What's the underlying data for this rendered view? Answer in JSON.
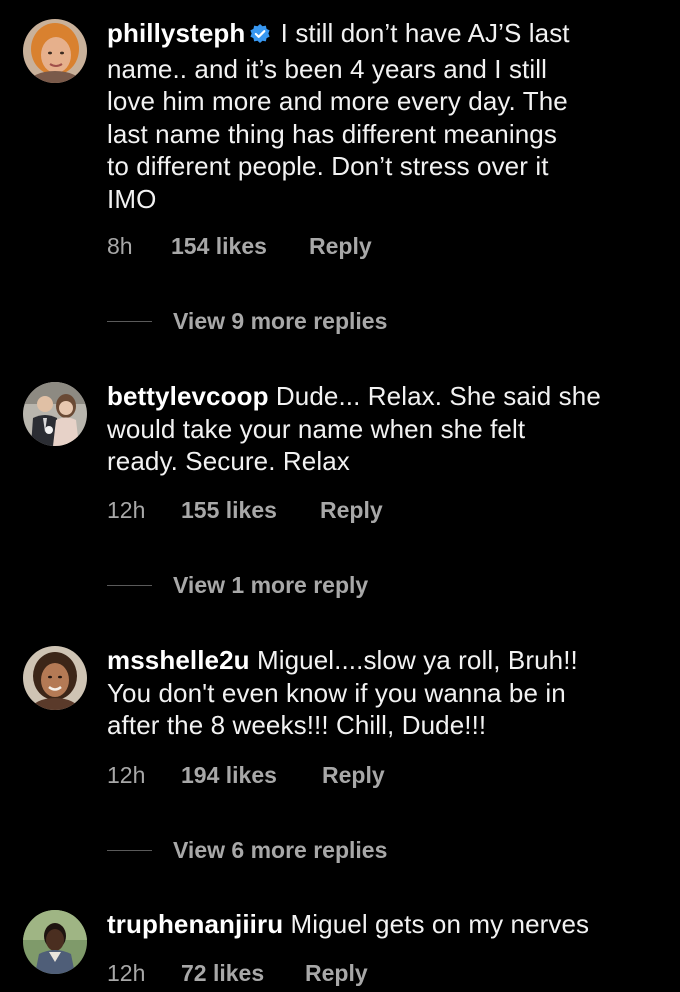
{
  "colors": {
    "background": "#000000",
    "text": "#f2f2f2",
    "secondary": "#a8a8a8",
    "verified": "#3897f0"
  },
  "comments": [
    {
      "username": "phillysteph",
      "verified": true,
      "lines": [
        "I still don’t have AJ’S last",
        "name.. and it’s been 4 years and I still",
        "love him more and more every day. The",
        "last name thing has different meanings",
        "to different people. Don’t stress over it",
        "IMO"
      ],
      "time": "8h",
      "likes": "154 likes",
      "reply": "Reply",
      "view_more": "View 9 more replies",
      "avatar_icon": "avatar-photo"
    },
    {
      "username": "bettylevcoop",
      "verified": false,
      "lines": [
        "Dude... Relax. She said she",
        "would take your name when she felt",
        "ready. Secure. Relax"
      ],
      "time": "12h",
      "likes": "155 likes",
      "reply": "Reply",
      "view_more": "View 1 more reply",
      "avatar_icon": "avatar-photo"
    },
    {
      "username": "msshelle2u",
      "verified": false,
      "lines": [
        "Miguel....slow ya roll, Bruh!!",
        "You don't even know if you wanna be in",
        "after the 8 weeks!!! Chill, Dude!!!"
      ],
      "time": "12h",
      "likes": "194 likes",
      "reply": "Reply",
      "view_more": "View 6 more replies",
      "avatar_icon": "avatar-photo"
    },
    {
      "username": "truphenanjiiru",
      "verified": false,
      "lines": [
        "Miguel gets on my nerves"
      ],
      "time": "12h",
      "likes": "72 likes",
      "reply": "Reply",
      "avatar_icon": "avatar-photo"
    }
  ]
}
